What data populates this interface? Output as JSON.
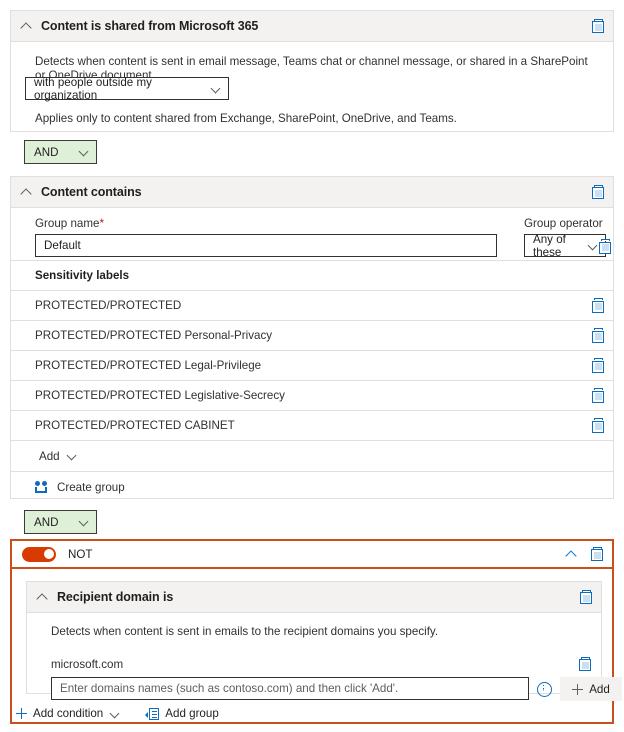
{
  "conditions": {
    "shared_from_m365": {
      "title": "Content is shared from Microsoft 365",
      "description": "Detects when content is sent in email message, Teams chat or channel message, or shared in a SharePoint or OneDrive document.",
      "scope_select_value": "with people outside my organization",
      "footnote": "Applies only to content shared from Exchange, SharePoint, OneDrive, and Teams."
    },
    "content_contains": {
      "title": "Content contains",
      "group_name_label": "Group name",
      "group_name_required_marker": "*",
      "group_name_value": "Default",
      "group_operator_label": "Group operator",
      "group_operator_value": "Any of these",
      "list_header": "Sensitivity labels",
      "items": [
        "PROTECTED/PROTECTED",
        "PROTECTED/PROTECTED Personal-Privacy",
        "PROTECTED/PROTECTED Legal-Privilege",
        "PROTECTED/PROTECTED Legislative-Secrecy",
        "PROTECTED/PROTECTED CABINET"
      ],
      "add_label": "Add",
      "create_group_label": "Create group"
    },
    "recipient_domain": {
      "title": "Recipient domain is",
      "description": "Detects when content is sent in emails to the recipient domains you specify.",
      "domains": [
        "microsoft.com"
      ],
      "input_placeholder": "Enter domains names (such as contoso.com) and then click 'Add'.",
      "input_value": "",
      "add_button_label": "Add"
    }
  },
  "operators": {
    "first": "AND",
    "second": "AND"
  },
  "not_group": {
    "label": "NOT",
    "toggle_on": true
  },
  "footer": {
    "add_condition_label": "Add condition",
    "add_group_label": "Add group"
  },
  "icons": {
    "collapse": "chevron-up-icon",
    "delete": "trash-icon",
    "dropdown": "chevron-down-icon",
    "info": "info-icon",
    "create_group": "create-group-icon",
    "add_group": "add-group-icon",
    "plus": "plus-icon"
  },
  "colors": {
    "not_accent": "#c94f1b",
    "toggle_on": "#d83b01",
    "operator_pill_bg": "#dff0d8",
    "icon_blue": "#0f6cbd",
    "header_bg": "#f3f2f1",
    "border": "#e1dfdd",
    "required_star": "#a4262c"
  }
}
